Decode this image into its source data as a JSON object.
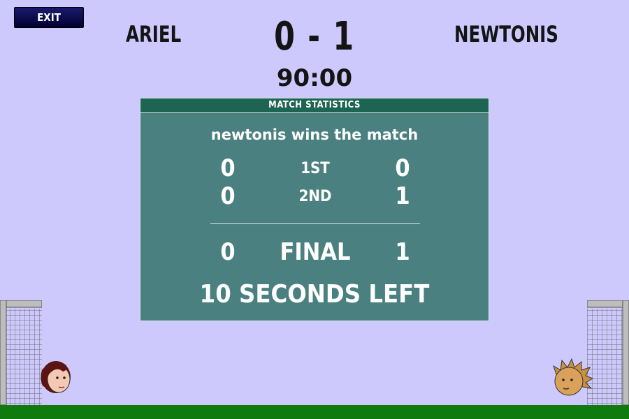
{
  "header": {
    "exit_label": "EXIT",
    "home_team": "ARIEL",
    "away_team": "NEWTONIS",
    "score": "0 - 1",
    "clock": "90:00"
  },
  "stats": {
    "title": "MATCH STATISTICS",
    "winner_text": "newtonis wins the match",
    "periods": [
      {
        "label": "1ST",
        "home": "0",
        "away": "0"
      },
      {
        "label": "2ND",
        "home": "0",
        "away": "1"
      }
    ],
    "final": {
      "label": "FINAL",
      "home": "0",
      "away": "1"
    },
    "countdown": "10 SECONDS LEFT"
  },
  "colors": {
    "sky": "#cdc9fd",
    "panel": "#4a8080",
    "panel_header": "#1e6452",
    "ground": "#0f7b0f",
    "exit_button": "#0a0a4a"
  }
}
